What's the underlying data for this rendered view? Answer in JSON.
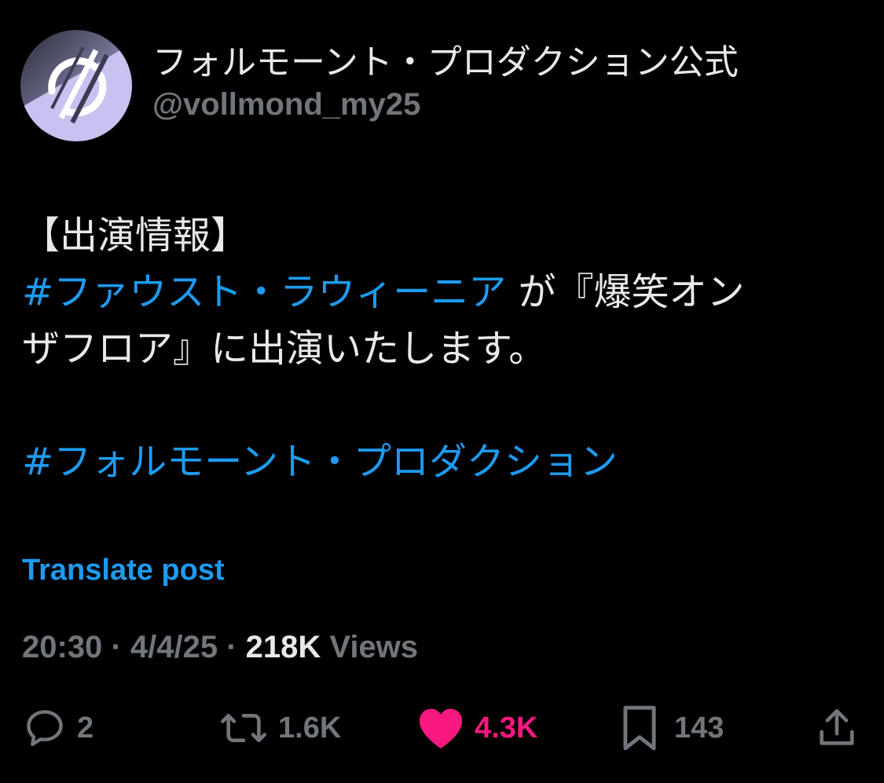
{
  "author": {
    "display_name": "フォルモーント・プロダクション公式",
    "handle": "@vollmond_my25",
    "avatar": "moon-logo-avatar"
  },
  "post": {
    "line1": "【出演情報】",
    "line2_hashtag": "#ファウスト・ラウィーニア",
    "line2_text": " が『爆笑オン",
    "line3": "ザフロア』に出演いたします。",
    "hashtag2": "#フォルモーント・プロダクション"
  },
  "translate_label": "Translate post",
  "meta": {
    "time": "20:30",
    "sep1": " · ",
    "date": "4/4/25",
    "sep2": " · ",
    "views_count": "218K",
    "views_label": " Views"
  },
  "actions": {
    "replies": {
      "icon": "reply-icon",
      "count": "2"
    },
    "reposts": {
      "icon": "repost-icon",
      "count": "1.6K"
    },
    "likes": {
      "icon": "heart-icon",
      "count": "4.3K"
    },
    "bookmarks": {
      "icon": "bookmark-icon",
      "count": "143"
    },
    "share": {
      "icon": "share-icon"
    }
  },
  "colors": {
    "background": "#000000",
    "text": "#e7e9ea",
    "muted": "#71767b",
    "link": "#1d9bf0",
    "like": "#f91880"
  }
}
